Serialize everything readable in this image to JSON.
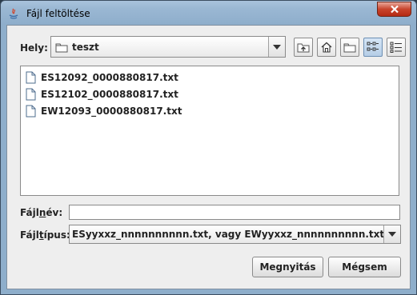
{
  "window": {
    "title": "Fájl feltöltése"
  },
  "location": {
    "label": "Hely:",
    "current_folder": "teszt"
  },
  "toolbar": {
    "icons": [
      "up-folder-icon",
      "home-icon",
      "new-folder-icon",
      "list-view-icon",
      "details-view-icon"
    ],
    "selected_view": "list-view"
  },
  "files": [
    {
      "name": "ES12092_0000880817.txt"
    },
    {
      "name": "ES12102_0000880817.txt"
    },
    {
      "name": "EW12093_0000880817.txt"
    }
  ],
  "filename": {
    "label_pre": "Fájl",
    "label_mnemonic": "n",
    "label_post": "év:",
    "value": ""
  },
  "filetype": {
    "label_pre": "Fájl",
    "label_mnemonic": "t",
    "label_post": "ípus:",
    "selected": "ESyyxxz_nnnnnnnnnn.txt, vagy EWyyxxz_nnnnnnnnnn.txt"
  },
  "buttons": {
    "open_label": "Megnyitás",
    "cancel_label": "Mégsem"
  },
  "colors": {
    "titlebar": "#9ab7d3",
    "close_button": "#c8442c",
    "dialog_bg": "#eeeeee"
  }
}
